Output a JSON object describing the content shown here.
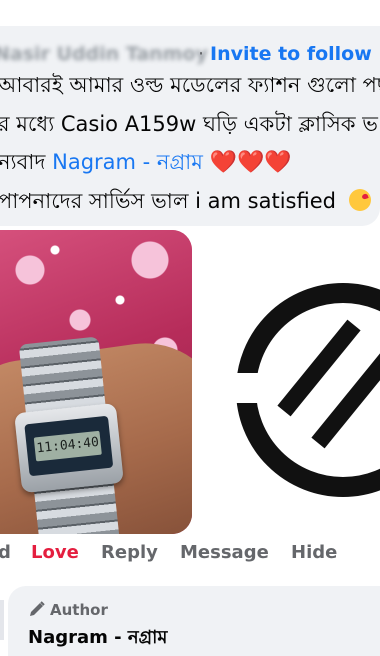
{
  "comment": {
    "author_name_blurred": "Nasir Uddin Tanmoy",
    "separator": "·",
    "invite_label": "Invite to follow",
    "lines": [
      "আবারই আমার ওল্ড মডেলের ফ্যাশন গুলো পছ",
      "র মধ্যে Casio A159w ঘড়ি একটা ক্লাসিক ভ",
      "পাপনাদের সার্ভিস ভাল i am satisfied"
    ],
    "line3_prefix": "ন্যবাদ",
    "mention": "Nagram - নগ্রাম",
    "hearts": "❤️❤️❤️",
    "emoji": "face-blowing-kiss"
  },
  "photo": {
    "watch_display": "11:04:40",
    "watch_brand": "CASIO"
  },
  "actions": {
    "like_fragment": "d",
    "love": "Love",
    "reply": "Reply",
    "message": "Message",
    "hide": "Hide"
  },
  "reply": {
    "author_badge": "Author",
    "name": "Nagram - নগ্রাম"
  },
  "colors": {
    "link": "#1877f2",
    "love": "#e41e3f",
    "muted": "#65676b",
    "bubble": "#f0f2f5"
  }
}
